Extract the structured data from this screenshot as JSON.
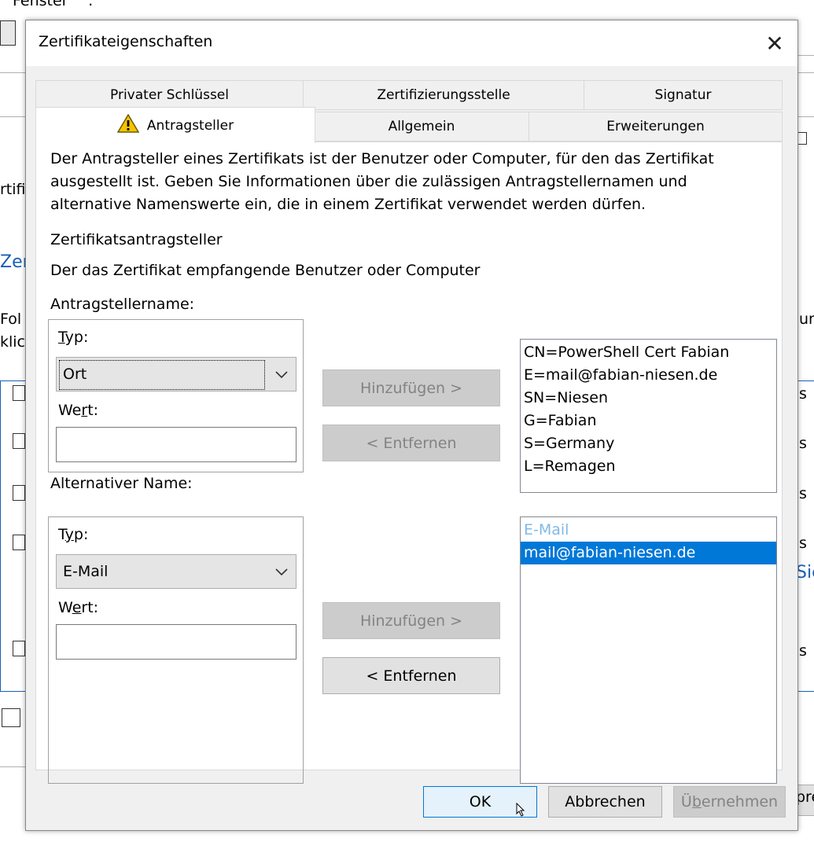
{
  "background": {
    "window_menu": "Fenster",
    "left_clips": [
      "rtifi",
      "Zer",
      "Fol",
      "klic"
    ],
    "right_clips": [
      "un",
      "s",
      "s",
      "s",
      "s",
      "Sie",
      "s",
      "pre"
    ]
  },
  "dialog": {
    "title": "Zertifikateigenschaften",
    "close_glyph": "✕",
    "tabs_row1": [
      "Privater Schlüssel",
      "Zertifizierungsstelle",
      "Signatur"
    ],
    "tabs_row2": [
      "Antragsteller",
      "Allgemein",
      "Erweiterungen"
    ],
    "description": [
      "Der Antragsteller eines Zertifikats ist der Benutzer oder Computer, für den das Zertifikat",
      "ausgestellt ist. Geben Sie Informationen über die zulässigen Antragstellernamen und",
      "alternative Namenswerte ein, die in einem Zertifikat verwendet werden dürfen."
    ],
    "section_title": "Zertifikatsantragsteller",
    "section_desc": "Der das Zertifikat empfangende Benutzer oder Computer",
    "subject": {
      "group_label": "Antragstellername:",
      "type_label_pre": "",
      "type_label_u": "T",
      "type_label_post": "yp:",
      "type_value": "Ort",
      "value_label_pre": "We",
      "value_label_u": "r",
      "value_label_post": "t:",
      "value": "",
      "add_button": "Hinzufügen >",
      "remove_button": "< Entfernen",
      "list": [
        "CN=PowerShell Cert Fabian",
        "E=mail@fabian-niesen.de",
        "SN=Niesen",
        "G=Fabian",
        "S=Germany",
        "L=Remagen"
      ]
    },
    "alternative": {
      "group_label": "Alternativer Name:",
      "type_label_pre": "T",
      "type_label_u": "y",
      "type_label_post": "p:",
      "type_value": "E-Mail",
      "value_label_pre": "W",
      "value_label_u": "e",
      "value_label_post": "rt:",
      "value": "",
      "add_button": "Hinzufügen >",
      "remove_button": "< Entfernen",
      "list_header": "E-Mail",
      "list_selected": "mail@fabian-niesen.de"
    },
    "footer": {
      "ok": "OK",
      "cancel": "Abbrechen",
      "apply_pre": "Ü",
      "apply_u": "b",
      "apply_post": "ernehmen"
    }
  },
  "colors": {
    "accent": "#0078d7",
    "warning": "#f5c400",
    "dialog_bg": "#f0f0f0",
    "disabled_text": "#838383"
  },
  "icons": [
    "warning-icon",
    "chevron-down-icon",
    "close-icon",
    "mouse-cursor-icon"
  ]
}
